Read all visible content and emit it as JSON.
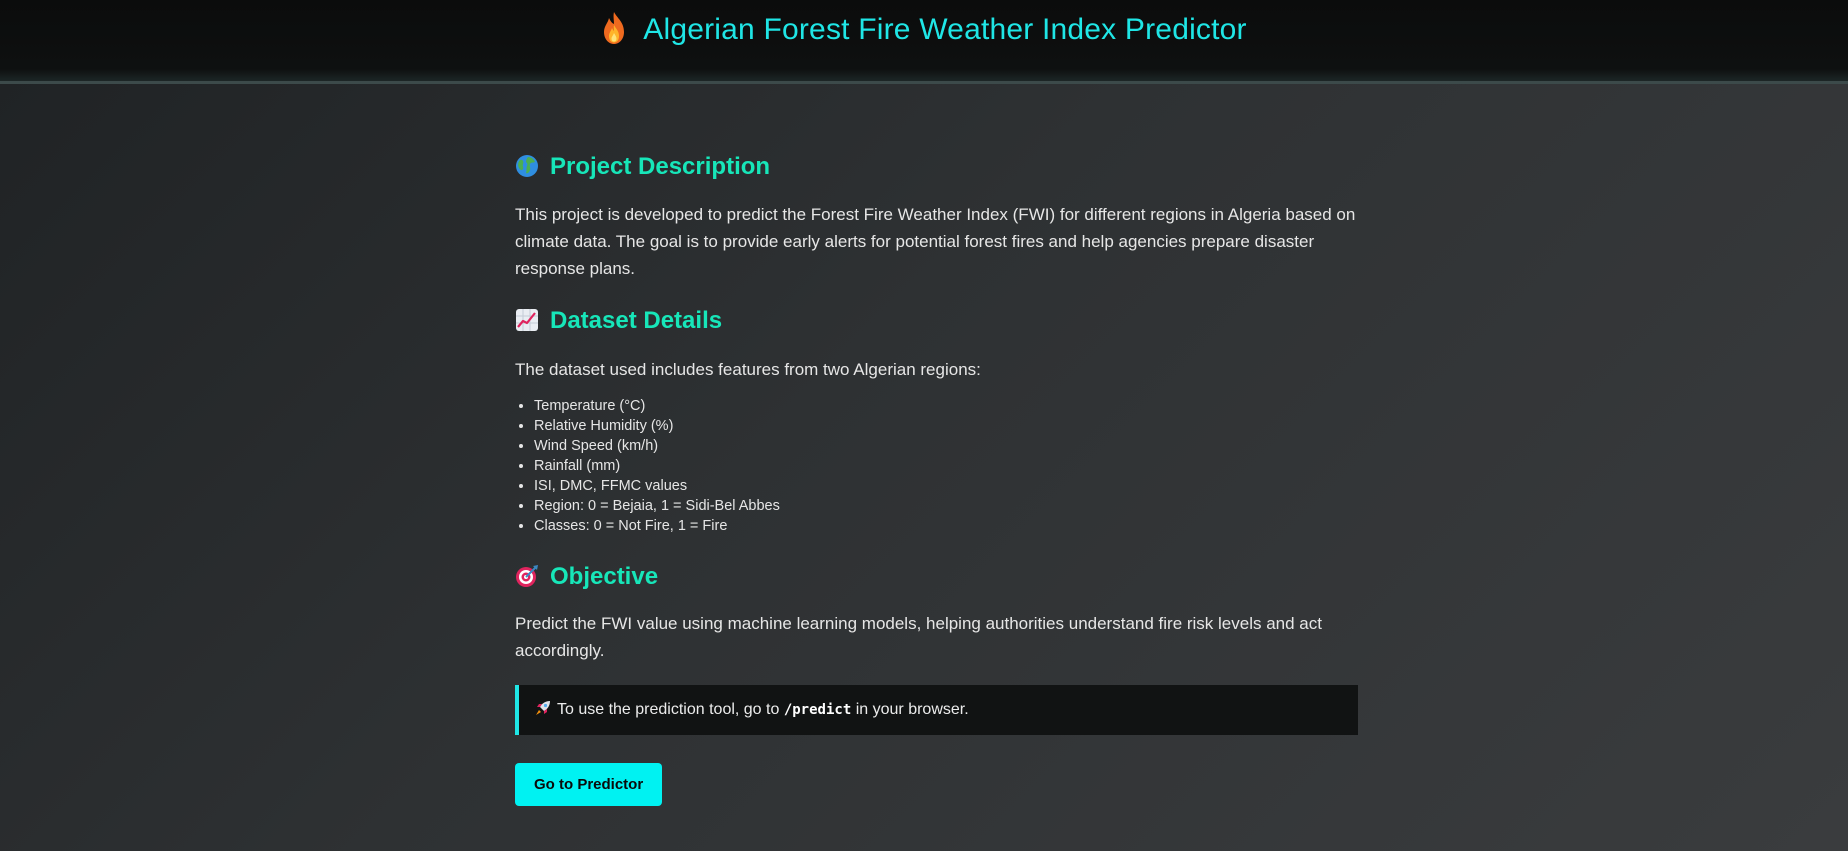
{
  "header": {
    "title": "Algerian Forest Fire Weather Index Predictor",
    "icon": "flame-icon"
  },
  "sections": {
    "description": {
      "icon": "globe-icon",
      "heading": "Project Description",
      "text": "This project is developed to predict the Forest Fire Weather Index (FWI) for different regions in Algeria based on climate data. The goal is to provide early alerts for potential forest fires and help agencies prepare disaster response plans."
    },
    "dataset": {
      "icon": "chart-increasing-icon",
      "heading": "Dataset Details",
      "intro": "The dataset used includes features from two Algerian regions:",
      "items": [
        "Temperature (°C)",
        "Relative Humidity (%)",
        "Wind Speed (km/h)",
        "Rainfall (mm)",
        "ISI, DMC, FFMC values",
        "Region: 0 = Bejaia, 1 = Sidi-Bel Abbes",
        "Classes: 0 = Not Fire, 1 = Fire"
      ]
    },
    "objective": {
      "icon": "target-icon",
      "heading": "Objective",
      "text": "Predict the FWI value using machine learning models, helping authorities understand fire risk levels and act accordingly."
    }
  },
  "hint": {
    "icon": "rocket-icon",
    "prefix": "To use the prediction tool, go to",
    "code": "/predict",
    "suffix": "in your browser."
  },
  "button": {
    "label": "Go to Predictor"
  },
  "colors": {
    "accent_cyan": "#1fe6e6",
    "heading_green": "#17e6b9",
    "button_bg": "#00f2f2"
  }
}
